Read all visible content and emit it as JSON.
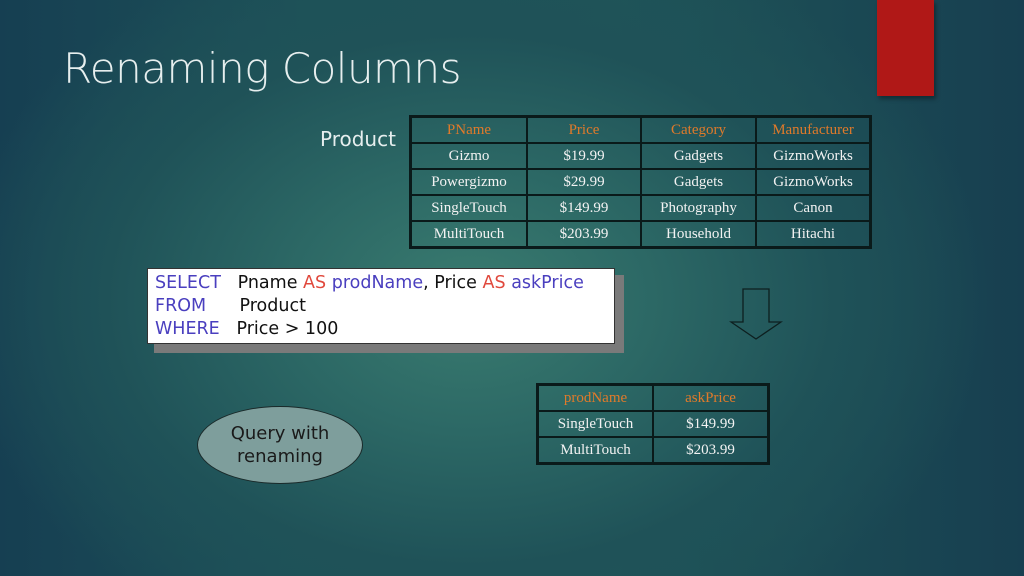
{
  "slide": {
    "title": "Renaming Columns",
    "accent_color": "#b01817"
  },
  "product_relation": {
    "label": "Product",
    "headers": [
      "PName",
      "Price",
      "Category",
      "Manufacturer"
    ],
    "rows": [
      [
        "Gizmo",
        "$19.99",
        "Gadgets",
        "GizmoWorks"
      ],
      [
        "Powergizmo",
        "$29.99",
        "Gadgets",
        "GizmoWorks"
      ],
      [
        "SingleTouch",
        "$149.99",
        "Photography",
        "Canon"
      ],
      [
        "MultiTouch",
        "$203.99",
        "Household",
        "Hitachi"
      ]
    ]
  },
  "query": {
    "select_kw": "SELECT",
    "col1": "Pname",
    "as1": "AS",
    "alias1": "prodName",
    "sep": ", ",
    "col2": "Price",
    "as2": "AS",
    "alias2": "askPrice",
    "from_kw": "FROM",
    "from_table": "Product",
    "where_kw": "WHERE",
    "where_cond": "Price > 100"
  },
  "arrow": {
    "icon": "down-arrow-icon"
  },
  "result_relation": {
    "headers": [
      "prodName",
      "askPrice"
    ],
    "rows": [
      [
        "SingleTouch",
        "$149.99"
      ],
      [
        "MultiTouch",
        "$203.99"
      ]
    ]
  },
  "callout": {
    "line1": "Query with",
    "line2": "renaming"
  }
}
